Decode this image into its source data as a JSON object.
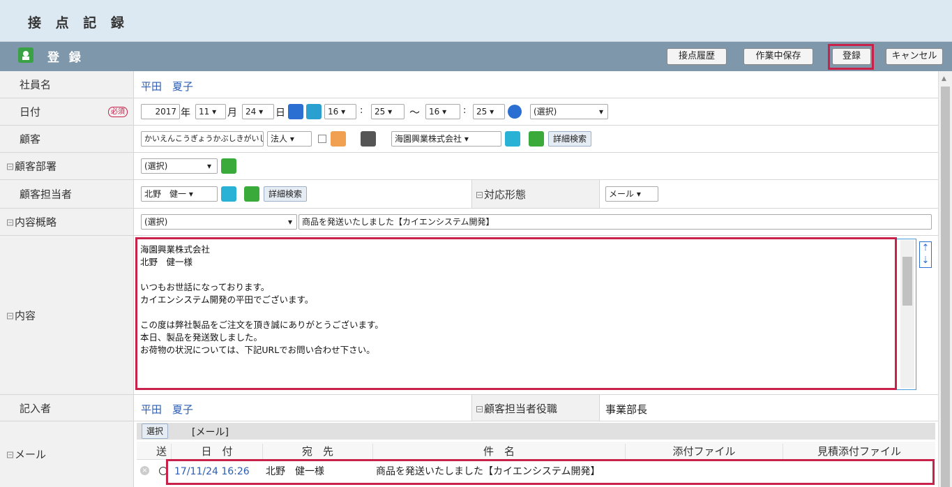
{
  "title": "接 点 記 録",
  "header": {
    "title": "登 録",
    "buttons": [
      "接点履歴",
      "作業中保存",
      "登録",
      "キャンセル"
    ]
  },
  "rows": {
    "employee": {
      "label": "社員名",
      "value": "平田　夏子"
    },
    "date": {
      "label": "日付",
      "required": "必須",
      "year": "2017",
      "year_unit": "年",
      "month": "11",
      "month_unit": "月",
      "day": "24",
      "day_unit": "日",
      "hour1": "16",
      "min1": "25",
      "tilde": "～",
      "hour2": "16",
      "min2": "25",
      "colon": ":",
      "select": "(選択)"
    },
    "customer": {
      "label": "顧客",
      "kana": "かいえんこうぎょうかぶしきがいし",
      "type": "法人",
      "company": "海園興業株式会社",
      "detail": "詳細検索"
    },
    "dept": {
      "label": "顧客部署",
      "select": "(選択)"
    },
    "contact": {
      "label": "顧客担当者",
      "select": "北野　健一",
      "detail": "詳細検索",
      "form_label": "対応形態",
      "form_value": "メール"
    },
    "summary": {
      "label": "内容概略",
      "select": "(選択)",
      "text": "商品を発送いたしました【カイエンシステム開発】"
    },
    "content": {
      "label": "内容",
      "text": "海園興業株式会社\n北野　健一様\n\nいつもお世話になっております。\nカイエンシステム開発の平田でございます。\n\nこの度は弊社製品をご注文を頂き誠にありがとうございます。\n本日、製品を発送致しました。\nお荷物の状況については、下記URLでお問い合わせ下さい。"
    },
    "writer": {
      "label": "記入者",
      "value": "平田　夏子",
      "role_label": "顧客担当者役職",
      "role_value": "事業部長"
    },
    "mail": {
      "label": "メール",
      "select_btn": "選択",
      "tab": "[メール]",
      "headers": [
        "送",
        "日　付",
        "宛　先",
        "件　名",
        "添付ファイル",
        "見積添付ファイル"
      ],
      "row": {
        "date": "17/11/24 16:26",
        "to": "北野　健一様",
        "subject": "商品を発送いたしました【カイエンシステム開発】"
      }
    }
  },
  "colors": {
    "accent": "#c8224b",
    "header": "#7f97aa"
  }
}
